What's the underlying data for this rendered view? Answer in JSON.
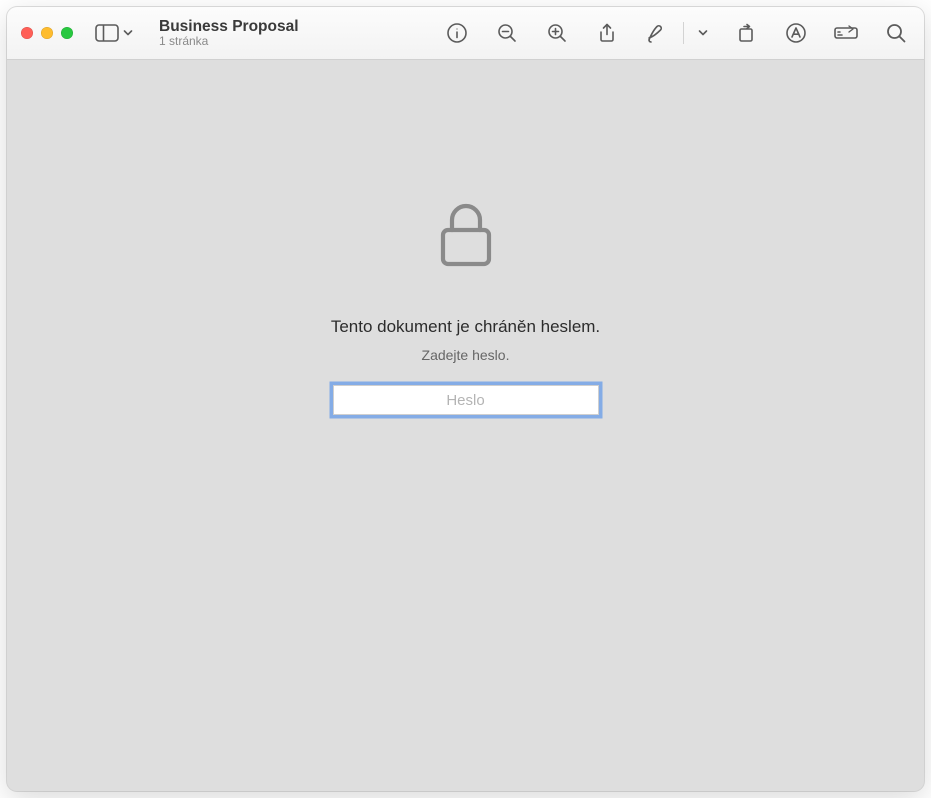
{
  "window": {
    "title": "Business Proposal",
    "subtitle": "1 stránka"
  },
  "toolbar": {
    "icons": {
      "sidebar": "sidebar-icon",
      "info": "info-icon",
      "zoom_out": "zoom-out-icon",
      "zoom_in": "zoom-in-icon",
      "share": "share-icon",
      "markup": "markup-icon",
      "dropdown": "chevron-down-icon",
      "rotate": "rotate-icon",
      "highlight": "highlight-icon",
      "form": "form-icon",
      "search": "search-icon"
    }
  },
  "content": {
    "heading": "Tento dokument je chráněn heslem.",
    "subheading": "Zadejte heslo.",
    "password_placeholder": "Heslo",
    "password_value": ""
  }
}
